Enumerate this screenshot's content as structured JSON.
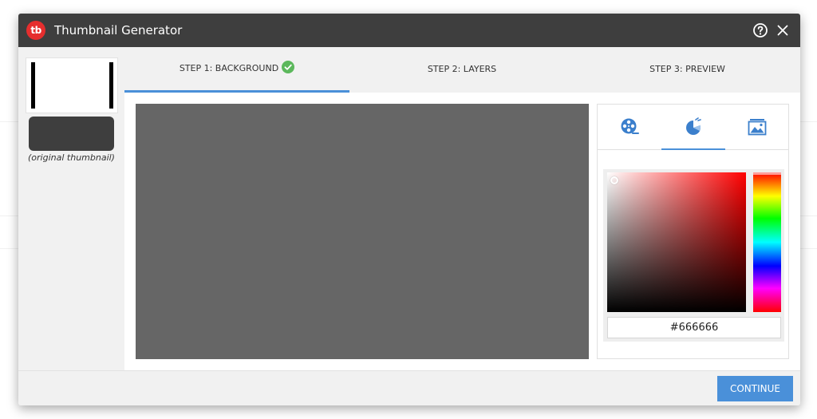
{
  "window": {
    "title": "Thumbnail Generator",
    "logo_text": "tb"
  },
  "sidebar": {
    "caption": "(original thumbnail)"
  },
  "steps": [
    {
      "label": "STEP 1: BACKGROUND",
      "completed": true,
      "active": true
    },
    {
      "label": "STEP 2: LAYERS",
      "completed": false,
      "active": false
    },
    {
      "label": "STEP 3: PREVIEW",
      "completed": false,
      "active": false
    }
  ],
  "panel_tabs": [
    {
      "icon": "film-reel-icon",
      "active": false
    },
    {
      "icon": "color-palette-icon",
      "active": true
    },
    {
      "icon": "image-gallery-icon",
      "active": false
    }
  ],
  "color_picker": {
    "hex": "#666666",
    "hue": "#ff0000"
  },
  "footer": {
    "continue_label": "CONTINUE"
  },
  "colors": {
    "accent": "#4a90d9",
    "titlebar": "#3e3e3e",
    "logo": "#e62e2e",
    "check": "#5cb85c",
    "background_preview": "#666666"
  }
}
